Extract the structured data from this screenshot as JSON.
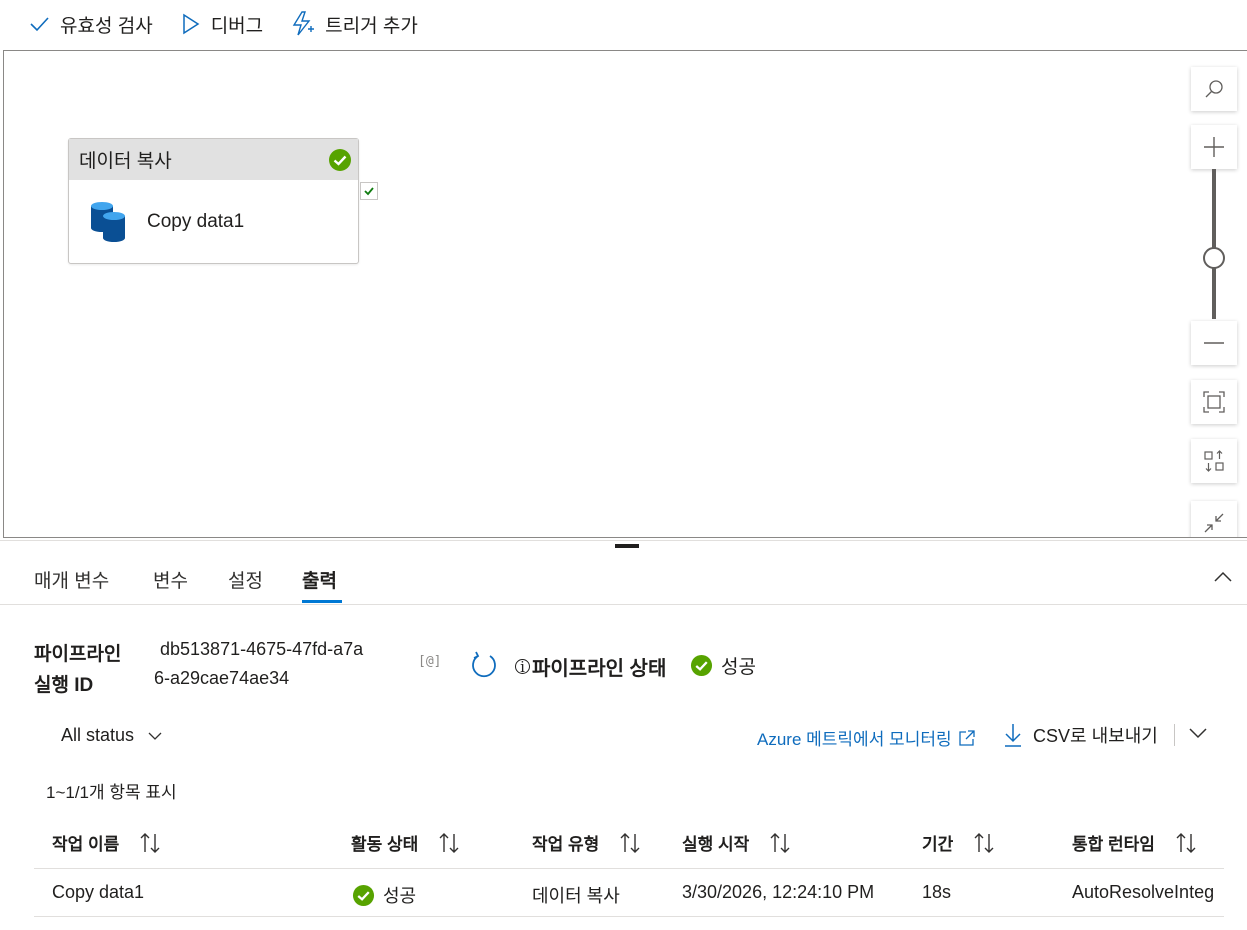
{
  "toolbar": {
    "validate_label": "유효성 검사",
    "debug_label": "디버그",
    "trigger_label": "트리거 추가"
  },
  "canvas": {
    "activity": {
      "type_label": "데이터 복사",
      "name": "Copy data1"
    }
  },
  "tabs": [
    {
      "label": "매개 변수"
    },
    {
      "label": "변수"
    },
    {
      "label": "설정"
    },
    {
      "label": "출력"
    }
  ],
  "output": {
    "run_id_label_line1": "파이프라인",
    "run_id_label_line2": "실행 ID",
    "run_id_line1": "db513871-4675-47fd-a7a",
    "run_id_line2": "6-a29cae74ae34",
    "copy_icon": "[@]",
    "status_label": "파이프라인 상태",
    "status_value": "성공",
    "filter_label": "All status",
    "azure_link": "Azure 메트릭에서 모니터링",
    "csv_label": "CSV로 내보내기",
    "count_text": "1~1/1개 항목 표시",
    "columns": [
      "작업 이름",
      "활동 상태",
      "작업 유형",
      "실행 시작",
      "기간",
      "통합 런타임"
    ],
    "rows": [
      {
        "name": "Copy data1",
        "status": "성공",
        "type": "데이터 복사",
        "start": "3/30/2026, 12:24:10 PM",
        "duration": "18s",
        "runtime": "AutoResolveInteg"
      }
    ]
  },
  "colors": {
    "accent": "#0078d4",
    "success": "#57a300",
    "link": "#0f6cbd"
  }
}
